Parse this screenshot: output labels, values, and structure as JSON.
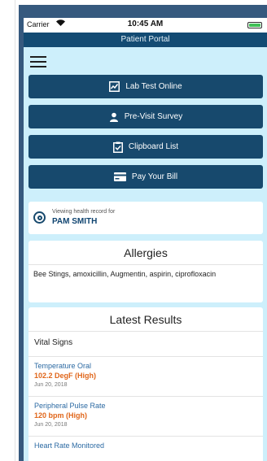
{
  "statusbar": {
    "carrier": "Carrier",
    "time": "10:45 AM"
  },
  "header": {
    "title": "Patient Portal"
  },
  "menu": {
    "icon": "hamburger-menu-icon"
  },
  "nav_buttons": [
    {
      "label": "Lab Test Online",
      "icon": "chart-icon"
    },
    {
      "label": "Pre-Visit Survey",
      "icon": "user-icon"
    },
    {
      "label": "Clipboard List",
      "icon": "clipboard-check-icon"
    },
    {
      "label": "Pay Your Bill",
      "icon": "credit-card-icon"
    }
  ],
  "viewing": {
    "caption": "Viewing health record for",
    "name": "PAM SMITH"
  },
  "allergies": {
    "title": "Allergies",
    "text": "Bee Stings,  amoxicillin,  Augmentin,  aspirin, ciprofloxacin"
  },
  "latest_results": {
    "title": "Latest Results",
    "section": "Vital Signs",
    "items": [
      {
        "name": "Temperature Oral",
        "value": "102.2 DegF (High)",
        "date": "Jun 20, 2018"
      },
      {
        "name": "Peripheral Pulse Rate",
        "value": "120 bpm (High)",
        "date": "Jun 20, 2018"
      },
      {
        "name": "Heart Rate Monitored",
        "value": "",
        "date": ""
      }
    ]
  },
  "colors": {
    "nav_button": "#17496d",
    "screen_background": "#cdeffb",
    "result_name": "#2c6aa3",
    "result_high": "#e0661a"
  }
}
